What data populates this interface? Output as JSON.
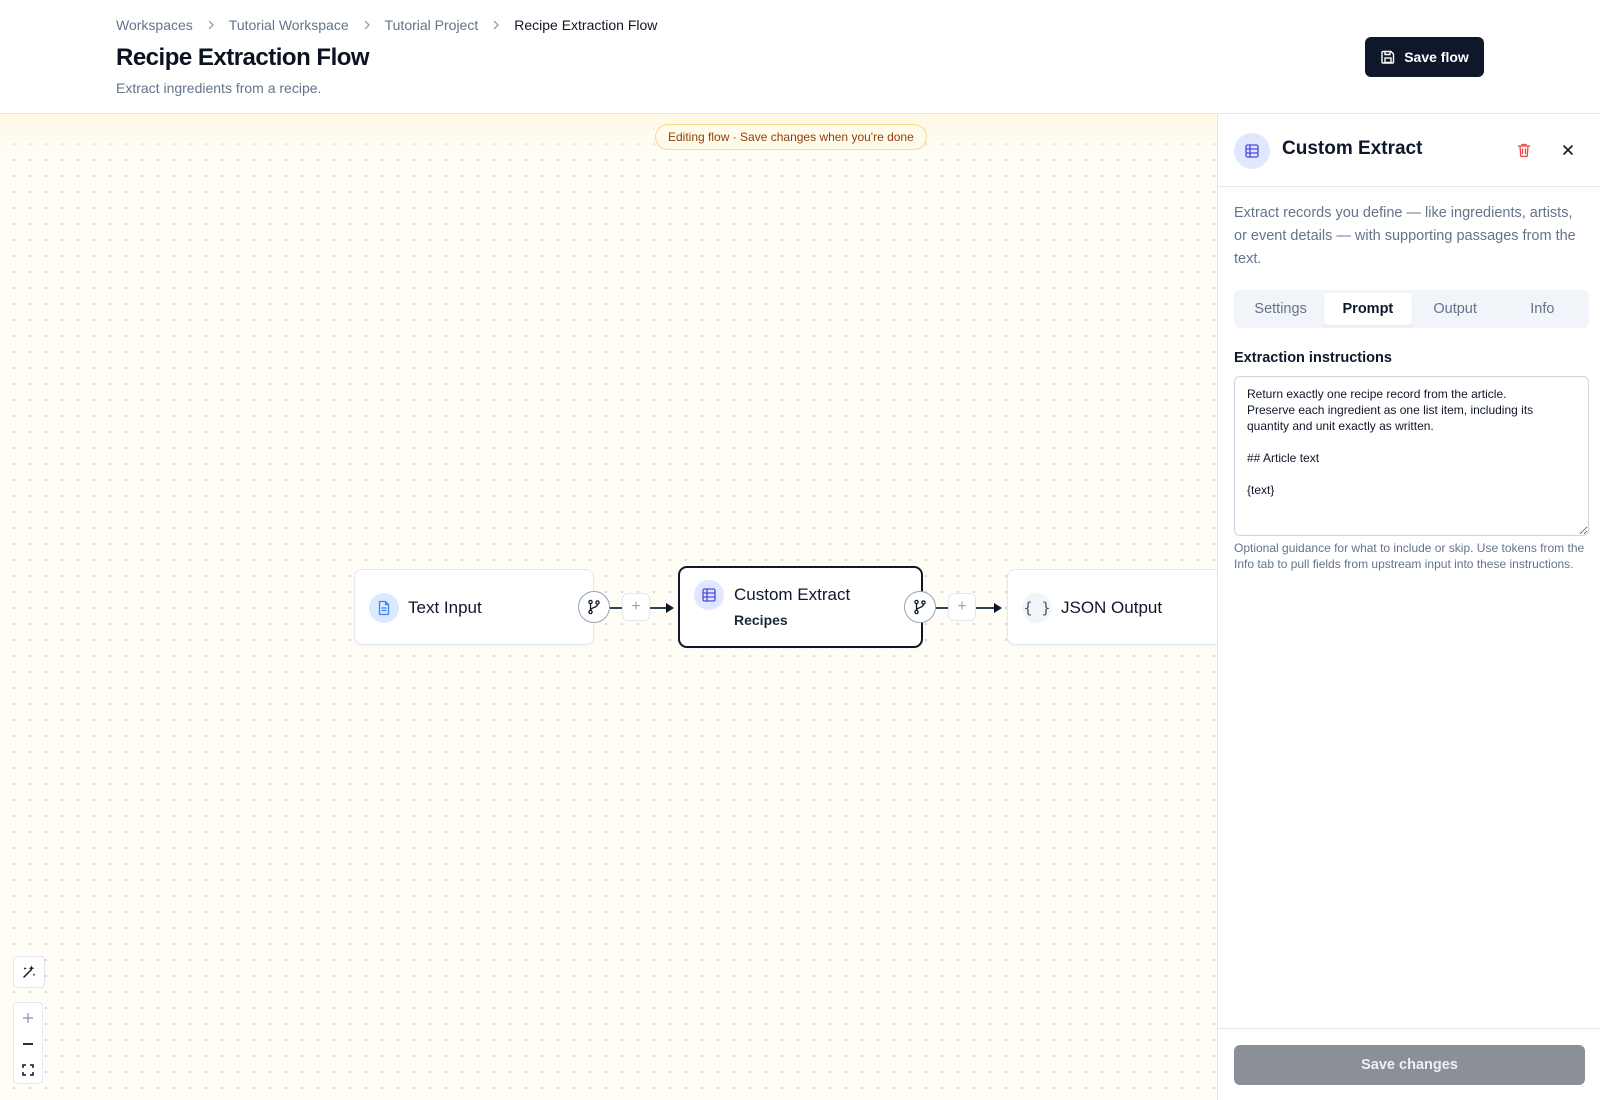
{
  "breadcrumb": {
    "items": [
      "Workspaces",
      "Tutorial Workspace",
      "Tutorial Project"
    ],
    "current": "Recipe Extraction Flow"
  },
  "page": {
    "title": "Recipe Extraction Flow",
    "subtitle": "Extract ingredients from a recipe."
  },
  "toolbar": {
    "save_flow_label": "Save flow"
  },
  "canvas": {
    "banner": "Editing flow · Save changes when you're done",
    "nodes": [
      {
        "title": "Text Input",
        "icon": "document-icon",
        "subtitle": ""
      },
      {
        "title": "Custom Extract",
        "icon": "table-icon",
        "subtitle": "Recipes"
      },
      {
        "title": "JSON Output",
        "icon": "braces-icon",
        "subtitle": ""
      }
    ],
    "colors": {
      "selected_border": "#0f172a",
      "dot_grid": "#d4d4d8",
      "background": "#fffdf6"
    }
  },
  "panel": {
    "title": "Custom Extract",
    "description": "Extract records you define — like ingredients, artists, or event details — with supporting passages from the text.",
    "tabs": [
      "Settings",
      "Prompt",
      "Output",
      "Info"
    ],
    "active_tab": "Prompt",
    "field_label": "Extraction instructions",
    "instructions": "Return exactly one recipe record from the article.\nPreserve each ingredient as one list item, including its quantity and unit exactly as written.\n\n## Article text\n\n{text}",
    "help_text": "Optional guidance for what to include or skip. Use tokens from the Info tab to pull fields from upstream input into these instructions.",
    "save_changes_label": "Save changes"
  }
}
